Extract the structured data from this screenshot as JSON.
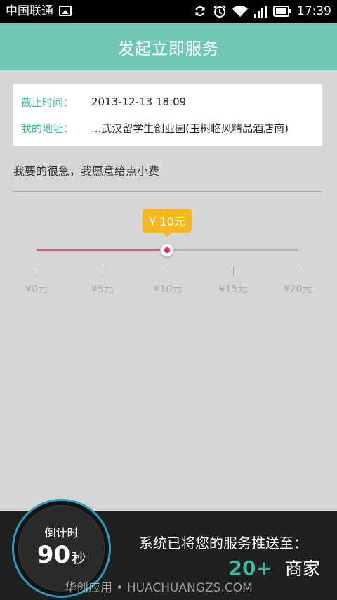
{
  "status_bar": {
    "carrier": "中国联通",
    "time": "17:39",
    "icons": [
      "image-icon",
      "sync-icon",
      "alarm-icon",
      "wifi-icon",
      "signal-icon",
      "battery-icon"
    ]
  },
  "header": {
    "title": "发起立即服务"
  },
  "info": {
    "deadline_label": "截止时间：",
    "deadline_value": "2013-12-13  18:09",
    "address_label": "我的地址：",
    "address_value": "...武汉留学生创业园(玉树临风精品酒店南)"
  },
  "tip": {
    "prompt": "我要的很急，我愿意给点小费",
    "selected_label": "¥ 10元",
    "selected_value": 10,
    "min": 0,
    "max": 20,
    "ticks": [
      "¥0元",
      "¥5元",
      "¥10元",
      "¥15元",
      "¥20元"
    ]
  },
  "countdown": {
    "caption": "倒计时",
    "value": "90",
    "unit": "秒"
  },
  "push": {
    "text": "系统已将您的服务推送至：",
    "count": "20+",
    "unit": "商家"
  },
  "watermark": "华创应用 • HUACHUANGZS.COM",
  "colors": {
    "accent": "#70c7b3",
    "label": "#3fb59c",
    "tooltip": "#f5b820",
    "track_fill": "#e25c72",
    "dial_ring": "#2a9cbc"
  }
}
